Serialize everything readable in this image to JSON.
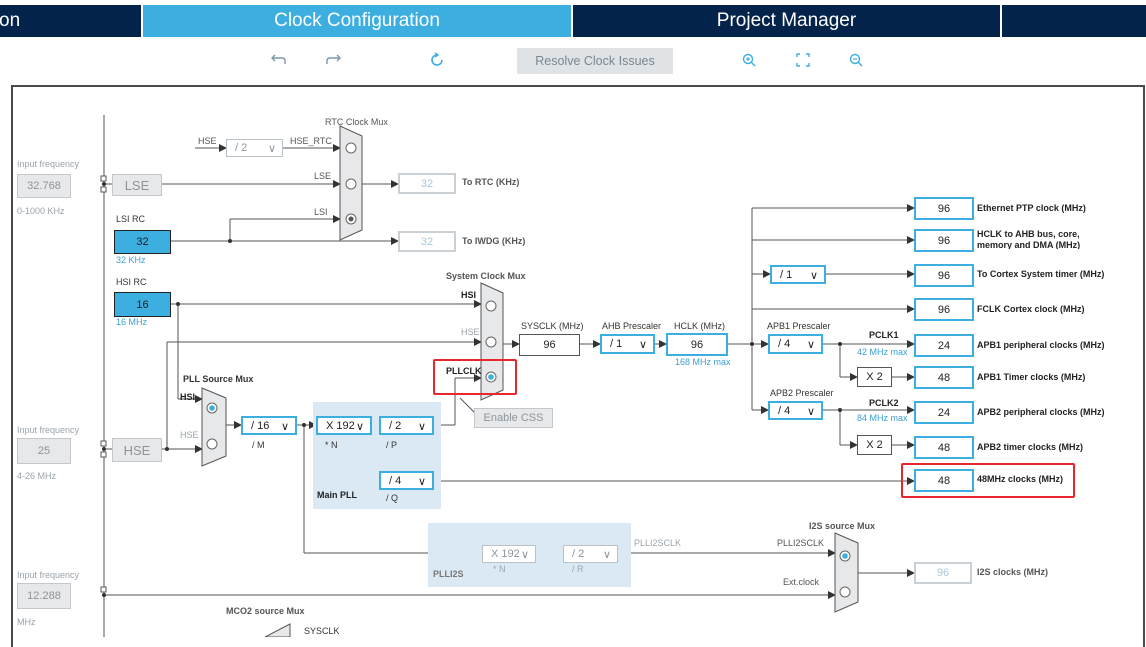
{
  "tabs": {
    "left_partial": "on",
    "clock_config": "Clock Configuration",
    "project_manager": "Project Manager"
  },
  "toolbar": {
    "undo_icon": "undo-icon",
    "redo_icon": "redo-icon",
    "refresh_icon": "refresh-icon",
    "resolve_label": "Resolve Clock Issues",
    "zoom_in_icon": "zoom-in-icon",
    "fit_icon": "fit-screen-icon",
    "zoom_out_icon": "zoom-out-icon"
  },
  "inputs": {
    "lse": {
      "title": "Input frequency",
      "value": "32.768",
      "range": "0-1000 KHz",
      "label": "LSE"
    },
    "hse": {
      "title": "Input frequency",
      "value": "25",
      "range": "4-26 MHz",
      "label": "HSE"
    },
    "i2s": {
      "title": "Input frequency",
      "value": "12.288",
      "unit": "MHz"
    }
  },
  "lsi": {
    "title": "LSI RC",
    "value": "32",
    "unit": "32 KHz"
  },
  "hsi": {
    "title": "HSI RC",
    "value": "16",
    "unit": "16 MHz"
  },
  "rtc": {
    "mux_title": "RTC Clock Mux",
    "hse_label": "HSE",
    "div": "/ 2",
    "hse_rtc": "HSE_RTC",
    "lse": "LSE",
    "lsi": "LSI",
    "rtc_value": "32",
    "rtc_label": "To RTC (KHz)",
    "iwdg_value": "32",
    "iwdg_label": "To IWDG (KHz)"
  },
  "sysmux": {
    "title": "System Clock Mux",
    "hsi": "HSI",
    "hse": "HSE",
    "pllclk": "PLLCLK",
    "enable_css": "Enable CSS"
  },
  "pll": {
    "source_title": "PLL Source Mux",
    "hsi": "HSI",
    "hse": "HSE",
    "m_value": "/ 16",
    "m_label": "/ M",
    "n_value": "X 192",
    "n_label": "* N",
    "p_value": "/ 2",
    "p_label": "/ P",
    "q_value": "/ 4",
    "q_label": "/ Q",
    "main_label": "Main PLL"
  },
  "plli2s": {
    "n_value": "X 192",
    "n_label": "* N",
    "r_value": "/ 2",
    "r_label": "/ R",
    "label": "PLLI2S",
    "clk_label": "PLLI2SCLK"
  },
  "sys": {
    "sysclk_label": "SYSCLK (MHz)",
    "sysclk": "96",
    "ahb_label": "AHB Prescaler",
    "ahb": "/ 1",
    "hclk_label": "HCLK (MHz)",
    "hclk": "96",
    "hclk_max": "168 MHz max",
    "apb1_label": "APB1 Prescaler",
    "apb1": "/ 4",
    "pclk1": "PCLK1",
    "pclk1_max": "42 MHz max",
    "apb2_label": "APB2 Prescaler",
    "apb2": "/ 4",
    "pclk2": "PCLK2",
    "pclk2_max": "84 MHz max",
    "cortex_div": "/ 1",
    "x2a": "X 2",
    "x2b": "X 2"
  },
  "outputs": [
    {
      "value": "96",
      "label": "Ethernet PTP clock (MHz)"
    },
    {
      "value": "96",
      "label": "HCLK to AHB bus, core, memory and DMA (MHz)"
    },
    {
      "value": "96",
      "label": "To Cortex System timer (MHz)"
    },
    {
      "value": "96",
      "label": "FCLK Cortex clock (MHz)"
    },
    {
      "value": "24",
      "label": "APB1 peripheral clocks (MHz)"
    },
    {
      "value": "48",
      "label": "APB1 Timer clocks (MHz)"
    },
    {
      "value": "24",
      "label": "APB2 peripheral clocks (MHz)"
    },
    {
      "value": "48",
      "label": "APB2 timer clocks (MHz)"
    },
    {
      "value": "48",
      "label": "48MHz clocks (MHz)"
    },
    {
      "value": "96",
      "label": "I2S clocks (MHz)"
    }
  ],
  "i2smux": {
    "title": "I2S source Mux",
    "plli2sclk": "PLLI2SCLK",
    "ext": "Ext.clock"
  },
  "mco2": {
    "title": "MCO2 source Mux",
    "sysclk": "SYSCLK"
  },
  "colors": {
    "dark_tab": "#03234b",
    "active_tab": "#3cafe0",
    "accent": "#3cafe0",
    "highlight": "#e8262b"
  }
}
